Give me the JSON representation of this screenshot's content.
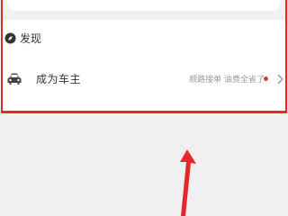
{
  "discover": {
    "icon": "compass-icon",
    "label": "发现"
  },
  "become_owner": {
    "icon": "car-icon",
    "label": "成为车主",
    "hint": "顺路接单 油费全省了",
    "badge_color": "#e53935",
    "chevron_icon": "chevron-right-icon"
  },
  "annotation": {
    "color": "#e8262a",
    "arrow_icon": "up-arrow-annotation"
  }
}
